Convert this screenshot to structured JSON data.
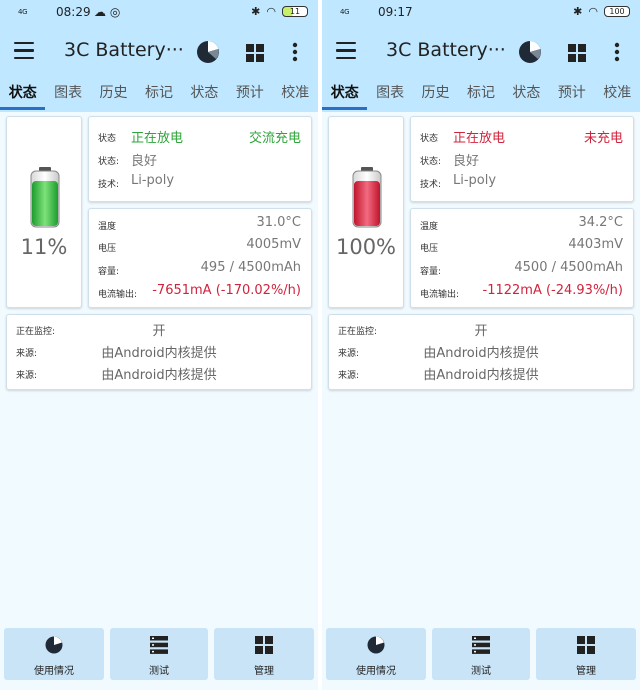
{
  "colors": {
    "topbar": "#bfe7ff",
    "background": "#f0faff",
    "green": "#2ea43a",
    "red": "#d0243c",
    "tab_indicator": "#2a6fc7"
  },
  "screens": [
    {
      "status_bar": {
        "network": "4G",
        "time": "08:29",
        "battery": "11"
      },
      "app_title": "3C Battery···",
      "tabs": [
        "状态",
        "图表",
        "历史",
        "标记",
        "状态",
        "预计",
        "校准"
      ],
      "battery_percent": "11%",
      "battery_level": 0.11,
      "battery_color": "green",
      "status": {
        "label": "状态",
        "value": "正在放电",
        "charge": "交流充电"
      },
      "health": {
        "label": "状态:",
        "value": "良好"
      },
      "tech": {
        "label": "技术:",
        "value": "Li-poly"
      },
      "temperature": {
        "label": "温度",
        "value": "31.0°C"
      },
      "voltage": {
        "label": "电压",
        "value": "4005mV"
      },
      "capacity": {
        "label": "容量:",
        "value": "495 / 4500mAh"
      },
      "current": {
        "label": "电流输出:",
        "value": "-7651mA (-170.02%/h)"
      },
      "monitoring": {
        "label": "正在监控:",
        "value": "开"
      },
      "source1": {
        "label": "来源:",
        "value": "由Android内核提供"
      },
      "source2": {
        "label": "来源:",
        "value": "由Android内核提供"
      },
      "bottom_nav": [
        "使用情况",
        "测试",
        "管理"
      ]
    },
    {
      "status_bar": {
        "network": "4G",
        "time": "09:17",
        "battery": "100"
      },
      "app_title": "3C Battery···",
      "tabs": [
        "状态",
        "图表",
        "历史",
        "标记",
        "状态",
        "预计",
        "校准"
      ],
      "battery_percent": "100%",
      "battery_level": 1.0,
      "battery_color": "red",
      "status": {
        "label": "状态",
        "value": "正在放电",
        "charge": "未充电"
      },
      "health": {
        "label": "状态:",
        "value": "良好"
      },
      "tech": {
        "label": "技术:",
        "value": "Li-poly"
      },
      "temperature": {
        "label": "温度",
        "value": "34.2°C"
      },
      "voltage": {
        "label": "电压",
        "value": "4403mV"
      },
      "capacity": {
        "label": "容量:",
        "value": "4500 / 4500mAh"
      },
      "current": {
        "label": "电流输出:",
        "value": "-1122mA (-24.93%/h)"
      },
      "monitoring": {
        "label": "正在监控:",
        "value": "开"
      },
      "source1": {
        "label": "来源:",
        "value": "由Android内核提供"
      },
      "source2": {
        "label": "来源:",
        "value": "由Android内核提供"
      },
      "bottom_nav": [
        "使用情况",
        "测试",
        "管理"
      ]
    }
  ]
}
